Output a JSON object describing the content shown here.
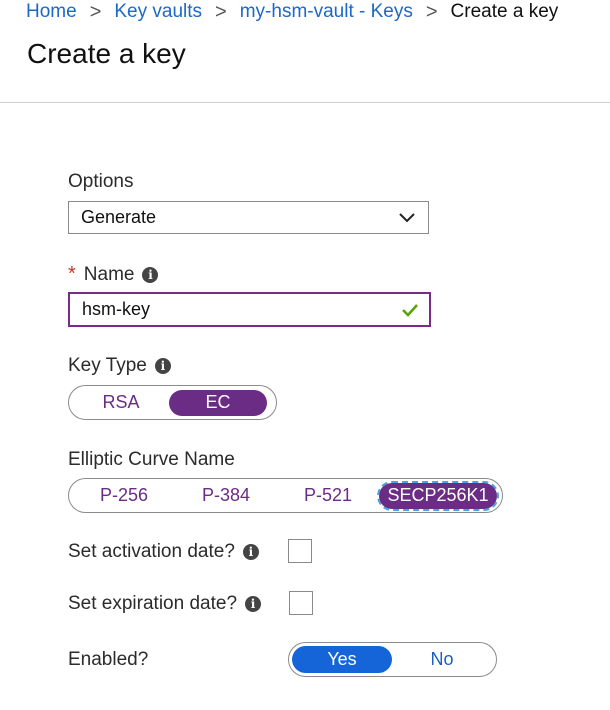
{
  "breadcrumb": {
    "items": [
      "Home",
      "Key vaults",
      "my-hsm-vault - Keys"
    ],
    "current": "Create a key",
    "separator": ">"
  },
  "page": {
    "title": "Create a key"
  },
  "options": {
    "label": "Options",
    "value": "Generate"
  },
  "name": {
    "label": "Name",
    "required_marker": "*",
    "value": "hsm-key",
    "valid": true
  },
  "key_type": {
    "label": "Key Type",
    "options": [
      "RSA",
      "EC"
    ],
    "selected": "EC"
  },
  "curve": {
    "label": "Elliptic Curve Name",
    "options": [
      "P-256",
      "P-384",
      "P-521",
      "SECP256K1"
    ],
    "selected": "SECP256K1"
  },
  "activation": {
    "label": "Set activation date?",
    "checked": false
  },
  "expiration": {
    "label": "Set expiration date?",
    "checked": false
  },
  "enabled": {
    "label": "Enabled?",
    "options": [
      "Yes",
      "No"
    ],
    "selected": "Yes"
  },
  "icons": {
    "info": "info-icon",
    "dropdown": "chevron-down-icon",
    "valid": "checkmark-icon"
  },
  "colors": {
    "link": "#1b68c8",
    "accent_purple": "#6a2c84",
    "toggle_blue": "#1565d8",
    "valid_green": "#57a300",
    "required_red": "#c0392b"
  }
}
